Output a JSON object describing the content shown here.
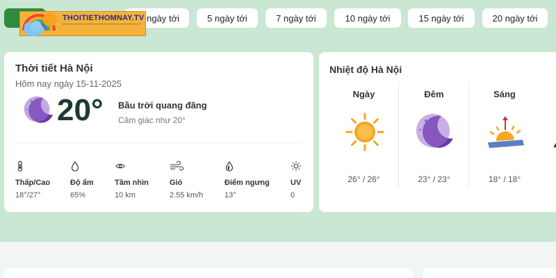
{
  "logo": {
    "text": "THOITIETHOMNAY.TV"
  },
  "tabs": [
    {
      "label": "ngày tới"
    },
    {
      "label": "5 ngày tới"
    },
    {
      "label": "7 ngày tới"
    },
    {
      "label": "10 ngày tới"
    },
    {
      "label": "15 ngày tới"
    },
    {
      "label": "20 ngày tới"
    }
  ],
  "current": {
    "title": "Thời tiết Hà Nội",
    "date": "Hôm nay ngày 15-11-2025",
    "temperature": "20°",
    "description": "Bầu trời quang đãng",
    "feels_like": "Cảm giác như 20°",
    "icon": "moon-icon",
    "stats": [
      {
        "label": "Thấp/Cao",
        "value": "18°/27°",
        "icon": "thermometer-icon"
      },
      {
        "label": "Độ ẩm",
        "value": "65%",
        "icon": "droplet-icon"
      },
      {
        "label": "Tầm nhìn",
        "value": "10 km",
        "icon": "eye-icon"
      },
      {
        "label": "Gió",
        "value": "2.55 km/h",
        "icon": "wind-icon"
      },
      {
        "label": "Điểm ngưng",
        "value": "13°",
        "icon": "dew-point-icon"
      },
      {
        "label": "UV",
        "value": "0",
        "icon": "sun-outline-icon"
      }
    ]
  },
  "temps": {
    "title": "Nhiệt độ Hà Nội",
    "columns": [
      {
        "label": "Ngày",
        "value": "26° / 26°",
        "icon": "sun-icon"
      },
      {
        "label": "Đêm",
        "value": "23° / 23°",
        "icon": "moon-icon"
      },
      {
        "label": "Sáng",
        "value": "18° / 18°",
        "icon": "sunrise-icon"
      }
    ]
  },
  "colors": {
    "page_bg": "#c9e7d2",
    "accent_green": "#2f8a3e",
    "sun_orange": "#f5a623",
    "moon_purple": "#6a3aa8"
  }
}
